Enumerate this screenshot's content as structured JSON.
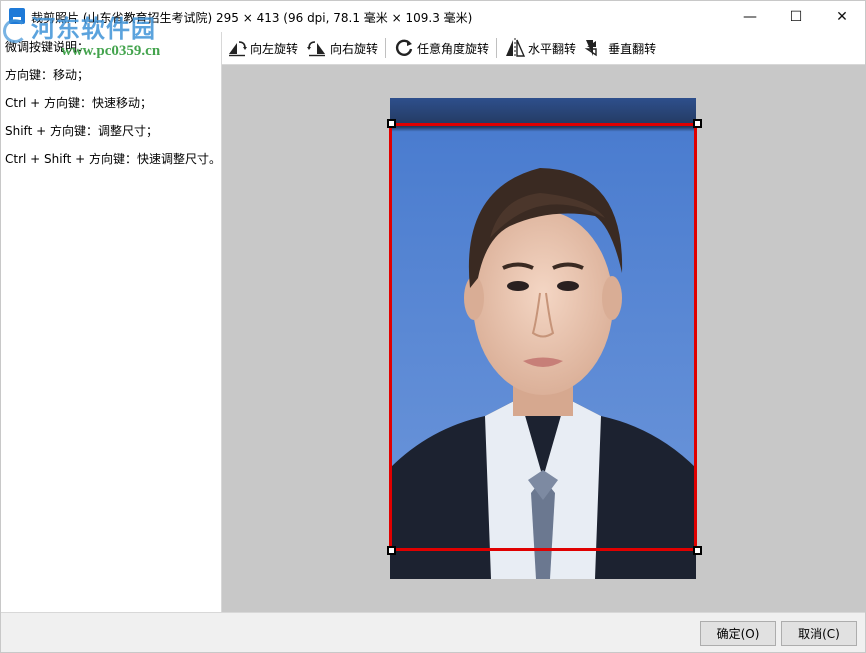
{
  "window": {
    "title": "裁剪照片 (山东省教育招生考试院) 295 × 413 (96 dpi, 78.1 毫米 × 109.3 毫米)",
    "minimize_glyph": "—",
    "maximize_glyph": "☐",
    "close_glyph": "✕"
  },
  "watermark": {
    "name": "河东软件园",
    "url": "www.pc0359.cn"
  },
  "help": {
    "lines": [
      "微调按键说明：",
      "方向键：移动；",
      "Ctrl + 方向键：快速移动；",
      "Shift + 方向键：调整尺寸；",
      "Ctrl + Shift + 方向键：快速调整尺寸。"
    ]
  },
  "toolbar": {
    "rotate_left": "向左旋转",
    "rotate_right": "向右旋转",
    "rotate_any": "任意角度旋转",
    "flip_horizontal": "水平翻转",
    "flip_vertical": "垂直翻转"
  },
  "buttons": {
    "ok": "确定(O)",
    "cancel": "取消(C)"
  },
  "colors": {
    "crop_frame": "#e00000",
    "photo_background": "#4a7ccf",
    "suit": "#1c2230",
    "tie": "#6b7890"
  },
  "icons": [
    "rotate-left-icon",
    "rotate-right-icon",
    "rotate-any-icon",
    "flip-horizontal-icon",
    "flip-vertical-icon",
    "app-icon"
  ]
}
